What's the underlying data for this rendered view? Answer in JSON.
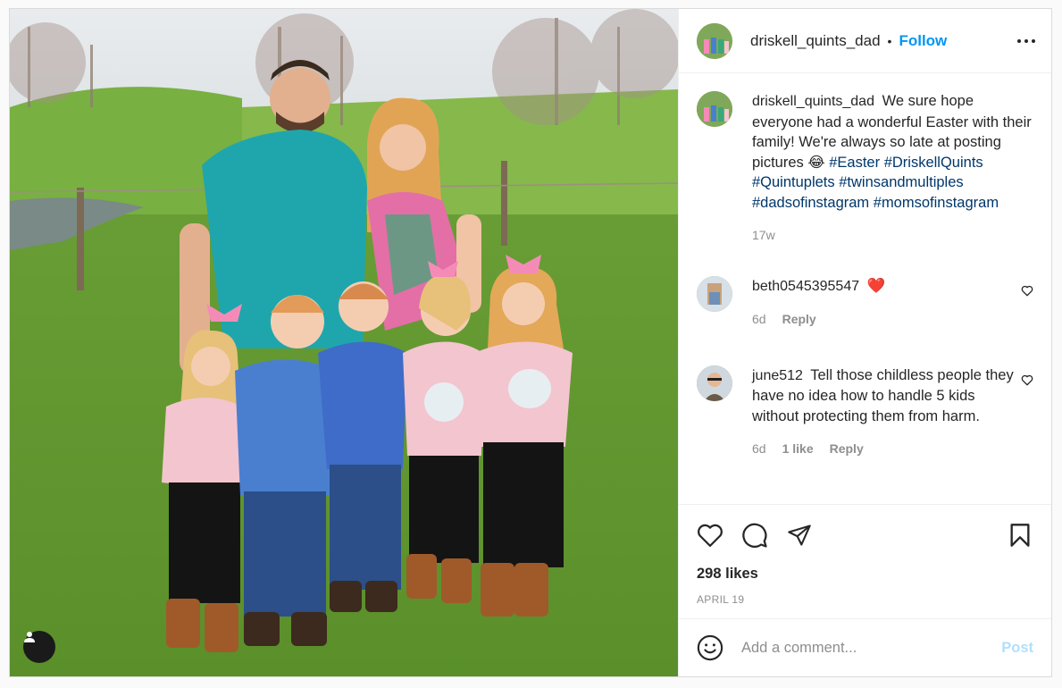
{
  "post": {
    "author": "driskell_quints_dad",
    "separator": "•",
    "follow_label": "Follow",
    "more_icon": "more-horizontal-icon",
    "likes": "298 likes",
    "date": "APRIL 19",
    "comment_placeholder": "Add a comment...",
    "post_label": "Post"
  },
  "caption": {
    "username": "driskell_quints_dad",
    "text": "We sure hope everyone had a wonderful Easter with their family! We're always so late at posting pictures 😂",
    "hashtags": [
      "#Easter",
      "#DriskellQuints",
      "#Quintuplets",
      "#twinsandmultiples",
      "#dadsofinstagram",
      "#momsofinstagram"
    ],
    "time": "17w"
  },
  "comments": [
    {
      "username": "beth0545395547",
      "text": "❤️",
      "time": "6d",
      "likes": "",
      "reply_label": "Reply"
    },
    {
      "username": "june512",
      "text": "Tell those childless people they have no idea how to handle 5 kids without protecting them from harm.",
      "time": "6d",
      "likes": "1 like",
      "reply_label": "Reply"
    }
  ],
  "colors": {
    "accent": "#0095f6",
    "hashtag": "#00376b",
    "muted": "#8e8e8e",
    "post_disabled": "#b2dffc"
  }
}
